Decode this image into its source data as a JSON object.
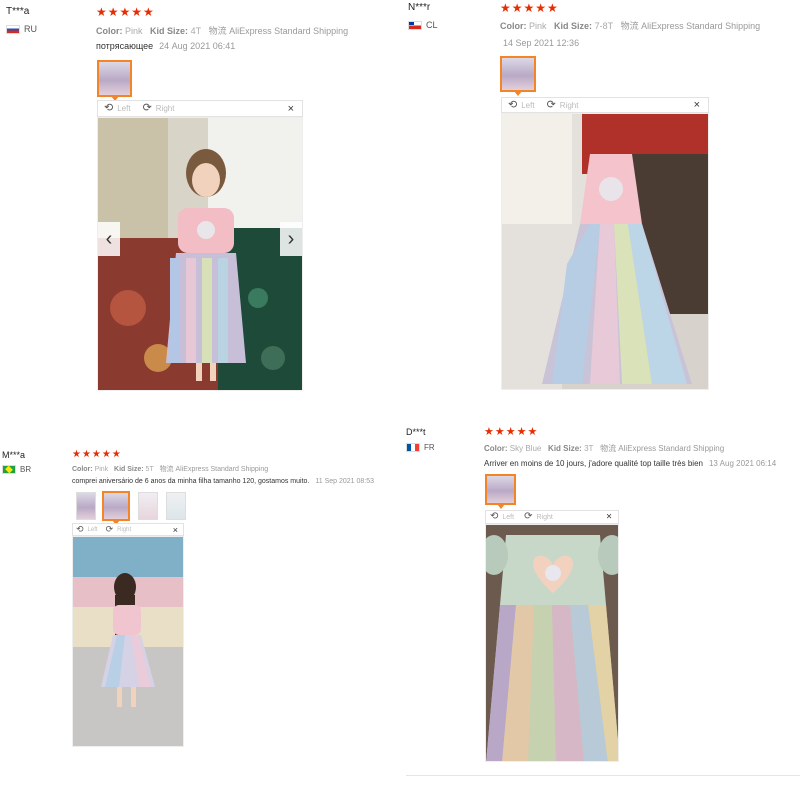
{
  "image_viewer": {
    "left_label": "Left",
    "right_label": "Right",
    "close_label": "×",
    "prev_arrow": "‹",
    "next_arrow": "›",
    "rotate_left_icon": "rotate-left-icon",
    "rotate_right_icon": "rotate-right-icon"
  },
  "rating_color": "#e62e04",
  "active_thumb_color": "#f48428",
  "reviews": [
    {
      "user": "T***a",
      "country": "RU",
      "stars": "★★★★★",
      "color_label": "Color:",
      "color_value": "Pink",
      "size_label": "Kid Size:",
      "size_value": "4T",
      "shipping": "物流 AliExpress Standard Shipping",
      "comment": "потрясающее",
      "date": "24 Aug 2021 06:41"
    },
    {
      "user": "N***r",
      "country": "CL",
      "stars": "★★★★★",
      "color_label": "Color:",
      "color_value": "Pink",
      "size_label": "Kid Size:",
      "size_value": "7-8T",
      "shipping": "物流 AliExpress Standard Shipping",
      "comment": "",
      "date": "14 Sep 2021 12:36"
    },
    {
      "user": "M***a",
      "country": "BR",
      "stars": "★★★★★",
      "color_label": "Color:",
      "color_value": "Pink",
      "size_label": "Kid Size:",
      "size_value": "5T",
      "shipping": "物流 AliExpress Standard Shipping",
      "comment": "comprei aniversário de 6 anos da minha filha tamanho 120, gostamos muito.",
      "date": "11 Sep 2021 08:53"
    },
    {
      "user": "D***t",
      "country": "FR",
      "stars": "★★★★★",
      "color_label": "Color:",
      "color_value": "Sky Blue",
      "size_label": "Kid Size:",
      "size_value": "3T",
      "shipping": "物流 AliExpress Standard Shipping",
      "comment": "Arriver en moins de 10 jours, j'adore qualité top taille très bien",
      "date": "13 Aug 2021 06:14"
    }
  ]
}
